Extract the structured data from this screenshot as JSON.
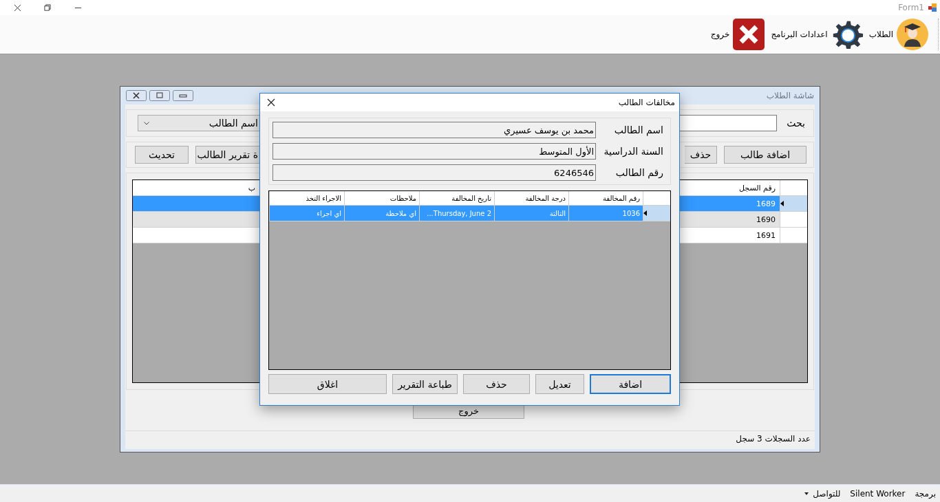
{
  "app_window": {
    "title": "Form1"
  },
  "toolbar": [
    {
      "label": "الطلاب",
      "kind": "students"
    },
    {
      "label": "اعدادات البرنامج",
      "kind": "settings"
    },
    {
      "label": "خروج",
      "kind": "exit"
    }
  ],
  "students_window": {
    "title": "شاشة الطلاب",
    "search_label": "بحث",
    "search_by": "اسم الطالب",
    "buttons_right": [
      {
        "label": "اضافة طالب"
      },
      {
        "label": "حذف"
      }
    ],
    "buttons_left": [
      {
        "label": "ة تقرير الطالب"
      },
      {
        "label": "تحديث"
      }
    ],
    "table": {
      "columns": [
        "رقم السجل",
        "ب"
      ],
      "rows": [
        {
          "cells": [
            "1689"
          ],
          "selected": true
        },
        {
          "cells": [
            "1690"
          ],
          "selected": false
        },
        {
          "cells": [
            "1691"
          ],
          "selected": false
        }
      ]
    },
    "exit_button": "خروج",
    "record_count": "عدد السجلات 3 سجل"
  },
  "violations_dialog": {
    "title": "مخالفات الطالب",
    "fields": [
      {
        "label": "اسم الطالب",
        "value": "محمد بن يوسف عسيري"
      },
      {
        "label": "السنة الدراسية",
        "value": "الأول المتوسط"
      },
      {
        "label": "رقم الطالب",
        "value": "6246546"
      }
    ],
    "table": {
      "columns": [
        "رقم المخالفة",
        "درجة المخالفة",
        "تاريخ المخالفة",
        "ملاحظات",
        "الاجراء التخذ"
      ],
      "rows": [
        {
          "cells": [
            "1036",
            "الثالثة",
            "Thursday, June 2...",
            "اي ملاحظة",
            "اي اجراء"
          ],
          "selected": true
        }
      ]
    },
    "buttons": [
      {
        "label": "اضافة",
        "focused": true
      },
      {
        "label": "تعديل",
        "focused": false
      },
      {
        "label": "حذف",
        "focused": false
      },
      {
        "label": "طباعة التقرير",
        "focused": false
      },
      {
        "label": "اغلاق",
        "focused": false
      }
    ]
  },
  "status_strip": [
    {
      "label": "برمجة",
      "kind": "text"
    },
    {
      "label": "Silent Worker",
      "kind": "text"
    },
    {
      "label": "للتواصل",
      "kind": "dropdown"
    }
  ]
}
